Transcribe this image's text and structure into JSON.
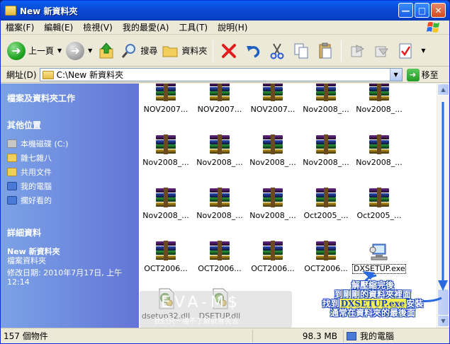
{
  "window": {
    "title": "New 新資料夾"
  },
  "menu": [
    "檔案(F)",
    "編輯(E)",
    "檢視(V)",
    "我的最愛(A)",
    "工具(T)",
    "說明(H)"
  ],
  "toolbar": {
    "back_label": "上一頁",
    "search_label": "搜尋",
    "folders_label": "資料夾"
  },
  "address": {
    "label": "網址(D)",
    "path": "C:\\New 新資料夾",
    "go_label": "移至"
  },
  "taskpane": {
    "tasks_title": "檔案及資料夾工作",
    "places_title": "其他位置",
    "places": [
      "本機磁碟 (C:)",
      "雜七雜八",
      "共用文件",
      "我的電腦",
      "擱好看的"
    ],
    "details_title": "詳細資料",
    "details_name": "New 新資料夾",
    "details_type": "檔案資料夾",
    "details_date_line1": "修改日期: 2010年7月17日, 上午",
    "details_date_line2": "12:14"
  },
  "files": [
    [
      "NOV2007...",
      "NOV2007...",
      "NOV2007...",
      "Nov2008_...",
      "Nov2008_..."
    ],
    [
      "Nov2008_...",
      "Nov2008_...",
      "Nov2008_...",
      "Nov2008_...",
      "Nov2008_..."
    ],
    [
      "Nov2008_...",
      "Nov2008_...",
      "Nov2008_...",
      "Oct2005_...",
      "Oct2005_..."
    ],
    [
      "OCT2006...",
      "OCT2006...",
      "OCT2006...",
      "OCT2006...",
      "DXSETUP.exe"
    ],
    [
      "dsetup32.dll",
      "DSETUP.dll"
    ]
  ],
  "watermark": {
    "title": "EVA-M$",
    "subtitle": "我們只一種不了解就會失去"
  },
  "annotation": {
    "line1": "解壓縮完後",
    "line2": "到剛剛的資料夾裡面",
    "line3_pre": "找到",
    "line3_hl": "DXSETUP.exe",
    "line3_post": "安裝",
    "line4": "通常在資料夾的最後面"
  },
  "status": {
    "count": "157 個物件",
    "size": "98.3 MB",
    "location": "我的電腦"
  },
  "colors": {
    "titlebar": "#0a49d5",
    "taskpane": "#6f8edf",
    "annotation": "#1a44b8",
    "highlight": "#f6f052"
  }
}
